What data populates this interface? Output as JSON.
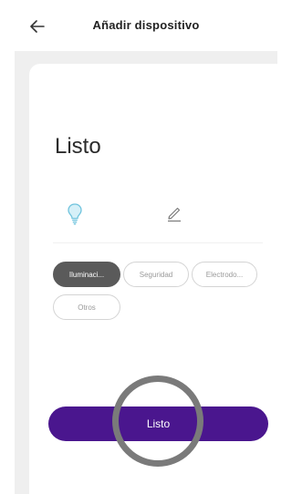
{
  "appbar": {
    "title": "Añadir dispositivo",
    "back_icon": "arrow-left-icon"
  },
  "card": {
    "heading": "Listo",
    "device_icon": "lightbulb-icon",
    "edit_icon": "pencil-icon"
  },
  "categories": [
    {
      "label": "Iluminaci...",
      "selected": true
    },
    {
      "label": "Seguridad",
      "selected": false
    },
    {
      "label": "Electrodo...",
      "selected": false
    },
    {
      "label": "Otros",
      "selected": false
    }
  ],
  "primary_button": {
    "label": "Listo"
  },
  "colors": {
    "primary": "#4a168e",
    "chip_selected": "#5a5a5a",
    "page_background": "#efefef",
    "tap_indicator": "#7a7a7a"
  }
}
